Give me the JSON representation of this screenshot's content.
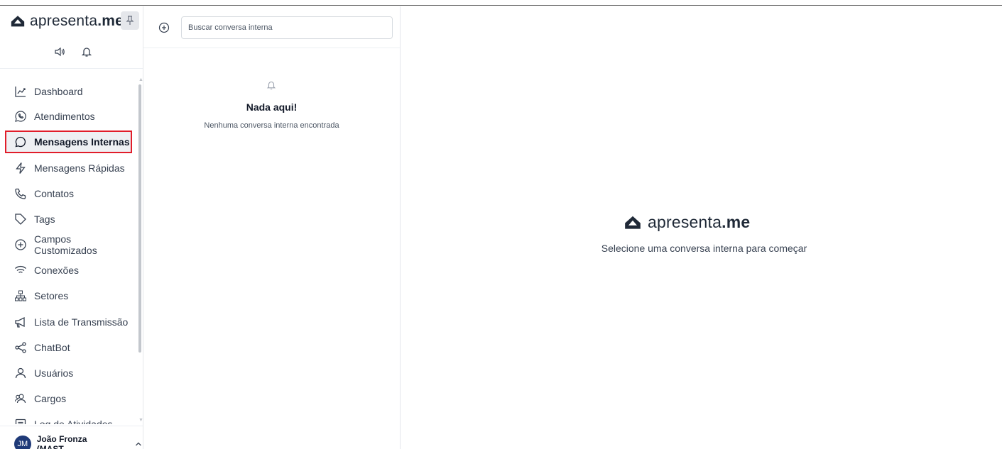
{
  "brand": {
    "name_light": "apresenta",
    "name_bold": ".me"
  },
  "sidebar": {
    "items": [
      {
        "label": "Dashboard",
        "icon": "chart-line-icon"
      },
      {
        "label": "Atendimentos",
        "icon": "whatsapp-icon"
      },
      {
        "label": "Mensagens Internas",
        "icon": "message-circle-icon",
        "active": true
      },
      {
        "label": "Mensagens Rápidas",
        "icon": "zap-icon"
      },
      {
        "label": "Contatos",
        "icon": "phone-icon"
      },
      {
        "label": "Tags",
        "icon": "tag-icon"
      },
      {
        "label": "Campos Customizados",
        "icon": "plus-circle-icon"
      },
      {
        "label": "Conexões",
        "icon": "wifi-icon"
      },
      {
        "label": "Setores",
        "icon": "hierarchy-icon"
      },
      {
        "label": "Lista de Transmissão",
        "icon": "megaphone-icon"
      },
      {
        "label": "ChatBot",
        "icon": "share-icon"
      },
      {
        "label": "Usuários",
        "icon": "user-icon"
      },
      {
        "label": "Cargos",
        "icon": "users-icon"
      },
      {
        "label": "Log de Atividades",
        "icon": "list-icon"
      }
    ],
    "user": {
      "initials": "JM",
      "name": "João Fronza (MAST..."
    }
  },
  "conversations": {
    "search_placeholder": "Buscar conversa interna",
    "empty_title": "Nada aqui!",
    "empty_subtitle": "Nenhuma conversa interna encontrada"
  },
  "main": {
    "message": "Selecione uma conversa interna para começar"
  },
  "colors": {
    "active_border": "#e11d2a",
    "avatar_bg": "#1f3a78",
    "text": "#1f2937"
  }
}
